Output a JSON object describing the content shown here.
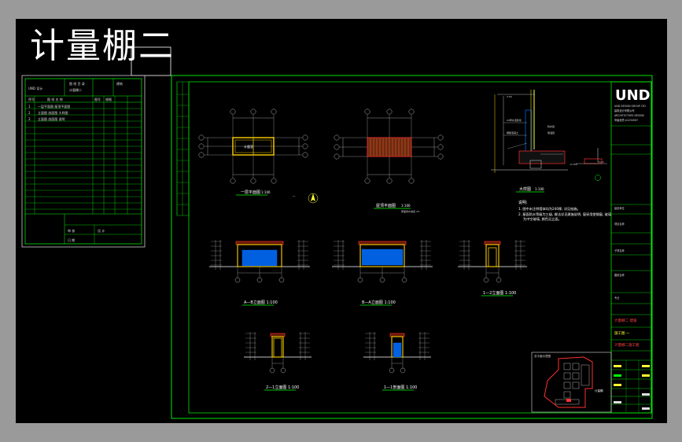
{
  "title": "计量棚二",
  "logo": "UND",
  "views": [
    {
      "id": "plan1",
      "label": "一层平面图"
    },
    {
      "id": "plan2",
      "label": "屋顶平面图"
    },
    {
      "id": "detail",
      "label": "大样图"
    },
    {
      "id": "elevA",
      "label": "A—B立面图"
    },
    {
      "id": "elevB",
      "label": "B—A立面图"
    },
    {
      "id": "elevC",
      "label": "1—2立面图"
    },
    {
      "id": "elevD",
      "label": "2—1立面图"
    },
    {
      "id": "elevE",
      "label": "1—1剖面图"
    }
  ],
  "scale": "1:100",
  "notes_heading": "说明:",
  "colors": {
    "frame": "#00ff00",
    "wall": "#ffd000",
    "glass": "#0070ff",
    "roof": "#ff3030",
    "text": "#ffffff"
  }
}
